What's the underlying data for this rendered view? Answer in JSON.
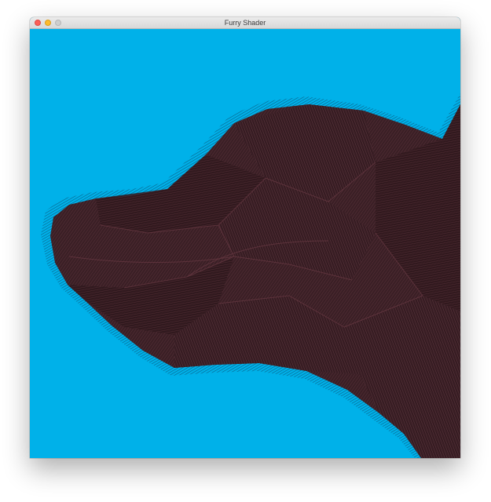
{
  "window": {
    "title": "Furry Shader"
  },
  "colors": {
    "background": "#00b1e9",
    "fur": "#3a1f25",
    "fur_highlight": "#6a3a44",
    "fur_tips": "#0d6f98"
  },
  "icons": {
    "close": "close-traffic-light-icon",
    "minimize": "minimize-traffic-light-icon",
    "zoom": "zoom-traffic-light-icon"
  }
}
